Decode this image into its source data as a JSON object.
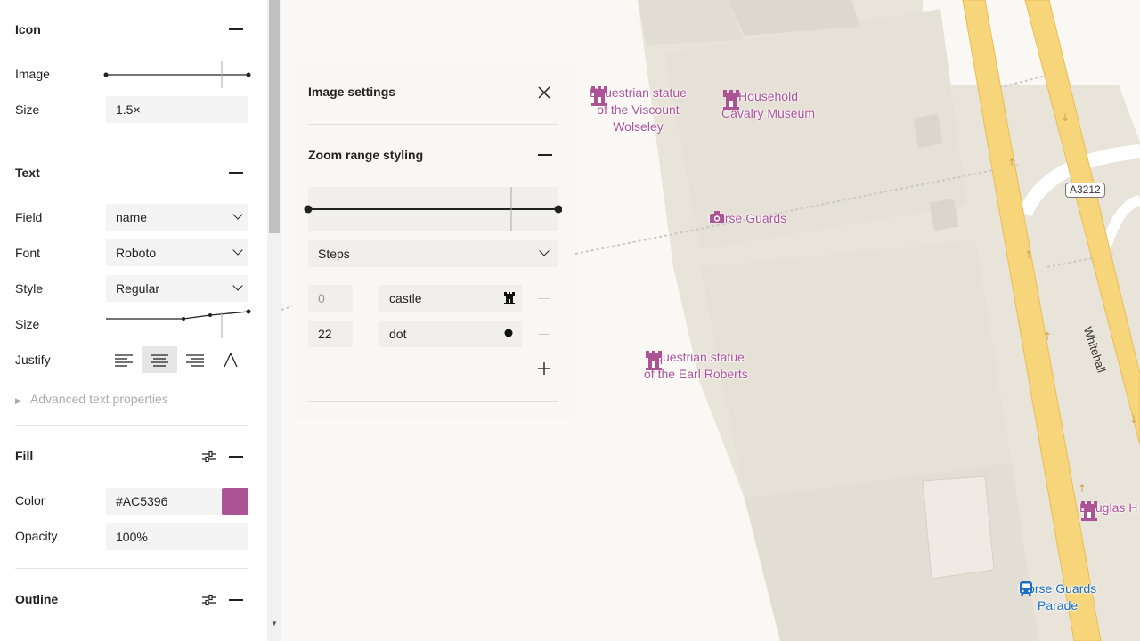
{
  "sidebar": {
    "icon": {
      "heading": "Icon",
      "image_label": "Image",
      "size_label": "Size",
      "size_value": "1.5×"
    },
    "text": {
      "heading": "Text",
      "field_label": "Field",
      "field_value": "name",
      "font_label": "Font",
      "font_value": "Roboto",
      "style_label": "Style",
      "style_value": "Regular",
      "size_label": "Size",
      "justify_label": "Justify",
      "advanced": "Advanced text properties"
    },
    "fill": {
      "heading": "Fill",
      "color_label": "Color",
      "color_value": "#AC5396",
      "swatch_color": "#AC5396",
      "opacity_label": "Opacity",
      "opacity_value": "100%"
    },
    "outline": {
      "heading": "Outline"
    }
  },
  "panel": {
    "title": "Image settings",
    "zoom_heading": "Zoom range styling",
    "interpolation": "Steps",
    "stops": [
      {
        "zoom": "0",
        "image": "castle",
        "icon": "castle-icon"
      },
      {
        "zoom": "22",
        "image": "dot",
        "icon": "dot-icon"
      }
    ]
  },
  "map": {
    "pois": [
      {
        "name": "Equestrian statue\nof the Viscount\nWolseley",
        "icon": "castle-icon"
      },
      {
        "name": "Household\nCavalry Museum",
        "icon": "castle-icon"
      },
      {
        "name": "Horse Guards",
        "icon": "camera-icon"
      },
      {
        "name": "Equestrian statue\nof the Earl Roberts",
        "icon": "castle-icon"
      },
      {
        "name": "Douglas H",
        "icon": "castle-icon"
      },
      {
        "name": "Horse Guards\nParade",
        "icon": "bus-icon"
      }
    ],
    "road_shield": "A3212",
    "street": "Whitehall",
    "colors": {
      "poi": "#ac5396",
      "transit": "#1a6fc2",
      "road": "#f7d57b",
      "building": "#e8e3d9"
    }
  }
}
